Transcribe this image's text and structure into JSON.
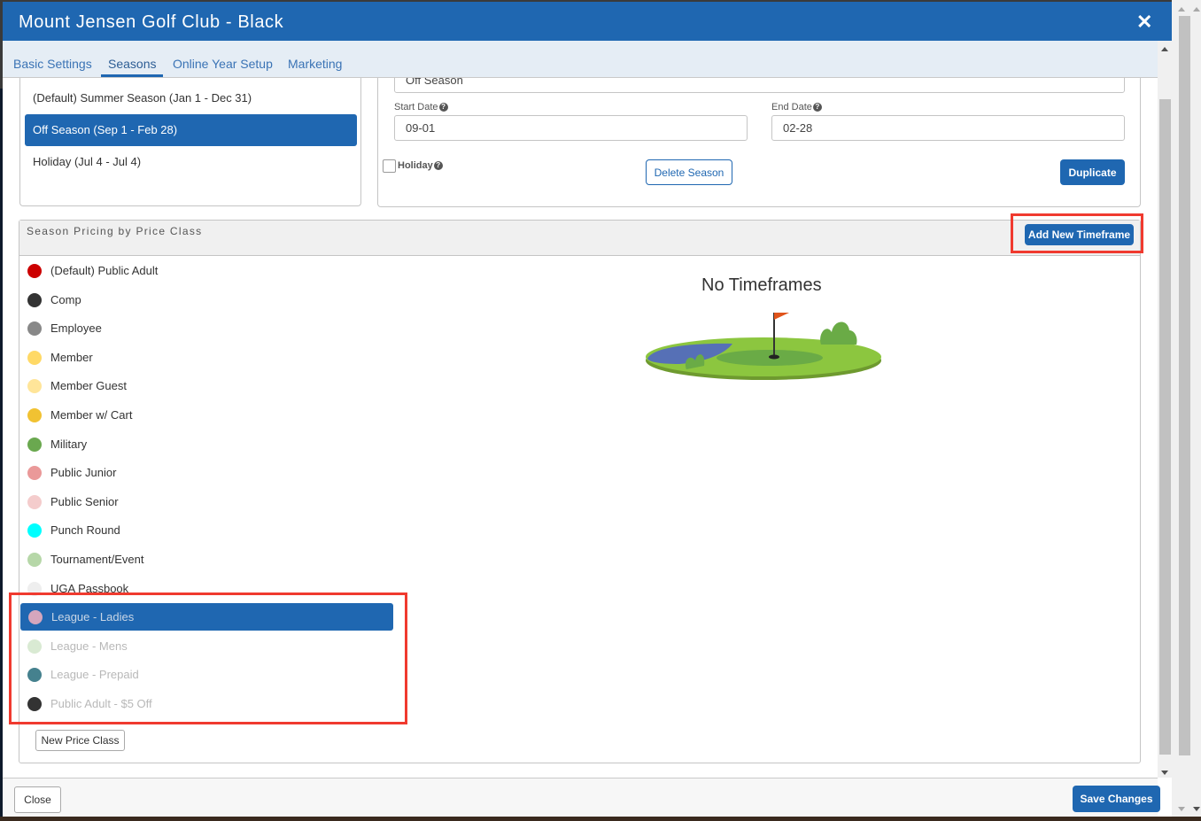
{
  "modal": {
    "title": "Mount Jensen Golf Club - Black",
    "close_icon": "close-icon"
  },
  "tabs": [
    {
      "label": "Basic Settings",
      "active": false
    },
    {
      "label": "Seasons",
      "active": true
    },
    {
      "label": "Online Year Setup",
      "active": false
    },
    {
      "label": "Marketing",
      "active": false
    }
  ],
  "seasons": {
    "items": [
      {
        "label": "(Default) Summer Season (Jan 1 - Dec 31)",
        "selected": false
      },
      {
        "label": "Off Season (Sep 1 - Feb 28)",
        "selected": true
      },
      {
        "label": "Holiday (Jul 4 - Jul 4)",
        "selected": false
      }
    ]
  },
  "season_form": {
    "name_value": "Off Season",
    "start_date_label": "Start Date",
    "start_date_value": "09-01",
    "end_date_label": "End Date",
    "end_date_value": "02-28",
    "holiday_label": "Holiday",
    "holiday_checked": false,
    "help_icon": "?",
    "delete_button": "Delete Season",
    "duplicate_button": "Duplicate"
  },
  "pricing": {
    "title": "Season Pricing by Price Class",
    "add_timeframe_button": "Add New Timeframe",
    "empty_message": "No Timeframes",
    "new_price_class_button": "New Price Class",
    "price_classes": [
      {
        "label": "(Default) Public Adult",
        "color": "#cc0000",
        "state": "normal"
      },
      {
        "label": "Comp",
        "color": "#333333",
        "state": "normal"
      },
      {
        "label": "Employee",
        "color": "#888888",
        "state": "normal"
      },
      {
        "label": "Member",
        "color": "#ffd966",
        "state": "normal"
      },
      {
        "label": "Member Guest",
        "color": "#ffe599",
        "state": "normal"
      },
      {
        "label": "Member w/ Cart",
        "color": "#f1c232",
        "state": "normal"
      },
      {
        "label": "Military",
        "color": "#6aa84f",
        "state": "normal"
      },
      {
        "label": "Public Junior",
        "color": "#ea9999",
        "state": "normal"
      },
      {
        "label": "Public Senior",
        "color": "#f4cccc",
        "state": "normal"
      },
      {
        "label": "Punch Round",
        "color": "#00ffff",
        "state": "normal"
      },
      {
        "label": "Tournament/Event",
        "color": "#b6d7a8",
        "state": "normal"
      },
      {
        "label": "UGA Passbook",
        "color": "#eeeeee",
        "state": "normal"
      },
      {
        "label": "League - Ladies",
        "color": "#d5a6bd",
        "state": "selected"
      },
      {
        "label": "League - Mens",
        "color": "#d9ead3",
        "state": "disabled"
      },
      {
        "label": "League - Prepaid",
        "color": "#45818e",
        "state": "disabled"
      },
      {
        "label": "Public Adult - $5 Off",
        "color": "#333333",
        "state": "disabled"
      }
    ]
  },
  "footer": {
    "close_button": "Close",
    "save_button": "Save Changes"
  },
  "colors": {
    "brand": "#1f67b1",
    "highlight": "#f03a2f"
  }
}
